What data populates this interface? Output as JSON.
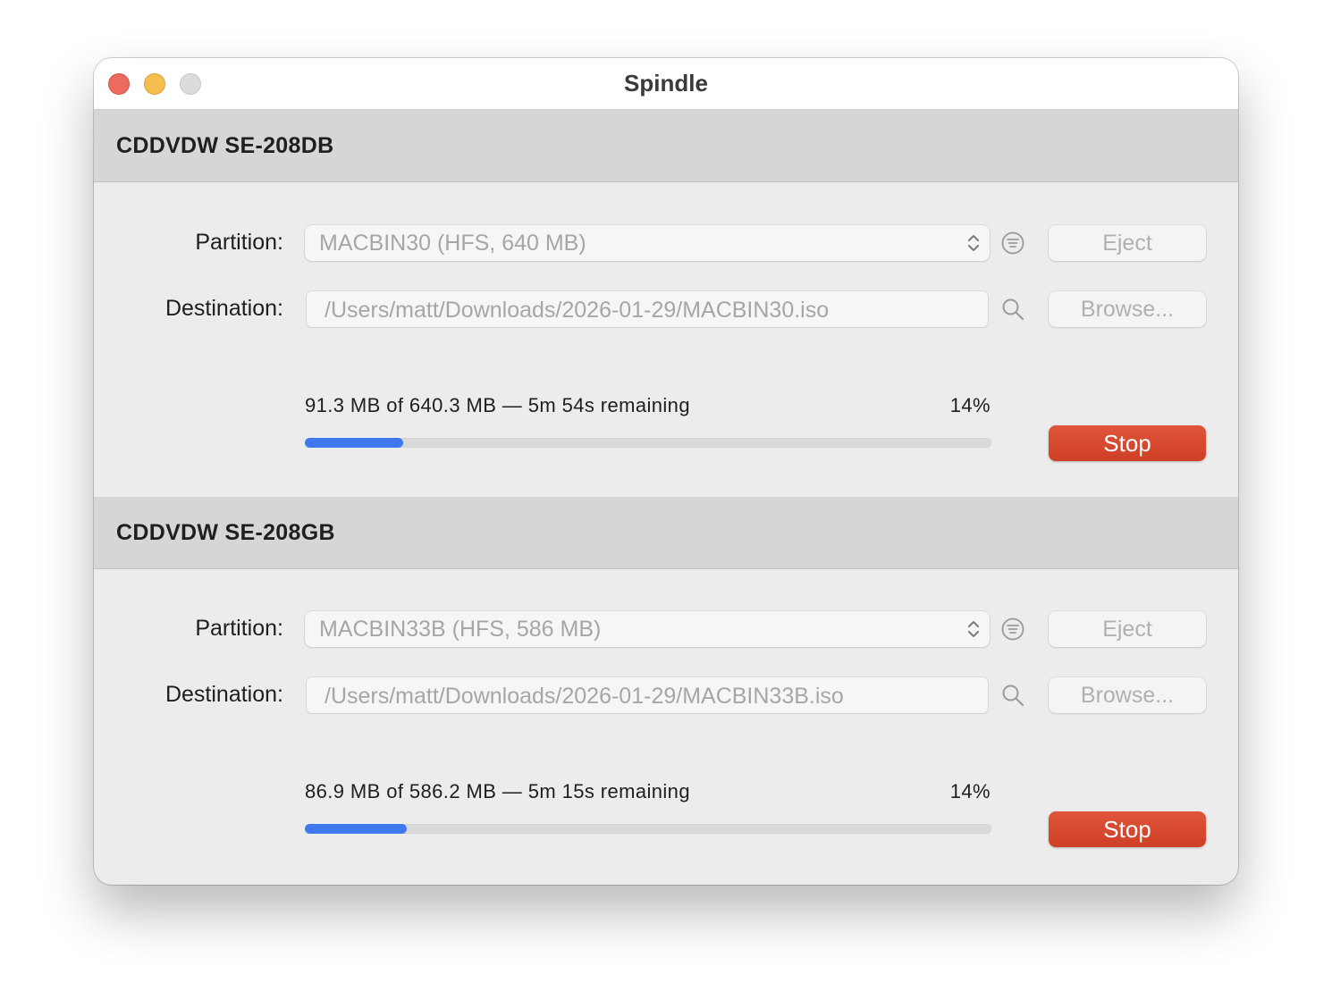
{
  "window": {
    "title": "Spindle"
  },
  "drives": [
    {
      "name": "CDDVDW SE-208DB",
      "partition_label": "Partition:",
      "partition_value": "MACBIN30 (HFS, 640 MB)",
      "eject_label": "Eject",
      "destination_label": "Destination:",
      "destination_value": "/Users/matt/Downloads/2026-01-29/MACBIN30.iso",
      "browse_label": "Browse...",
      "progress_text": "91.3 MB of 640.3 MB — 5m 54s remaining",
      "progress_percent_text": "14%",
      "progress_fraction": 0.143,
      "stop_label": "Stop"
    },
    {
      "name": "CDDVDW SE-208GB",
      "partition_label": "Partition:",
      "partition_value": "MACBIN33B (HFS, 586 MB)",
      "eject_label": "Eject",
      "destination_label": "Destination:",
      "destination_value": "/Users/matt/Downloads/2026-01-29/MACBIN33B.iso",
      "browse_label": "Browse...",
      "progress_text": "86.9 MB of 586.2 MB — 5m 15s remaining",
      "progress_percent_text": "14%",
      "progress_fraction": 0.148,
      "stop_label": "Stop"
    }
  ],
  "icons": {
    "partition_info": "list-circle-icon",
    "destination_search": "magnifier-icon",
    "popup_chevron": "chevron-up-down-icon"
  },
  "colors": {
    "accent": "#3f78ee",
    "stop": "#d9472d",
    "close": "#ed6a5e",
    "minimize": "#f5bf4f"
  }
}
